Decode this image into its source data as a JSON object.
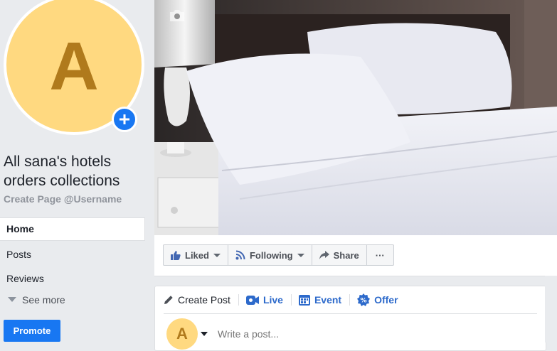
{
  "page": {
    "avatar_letter": "A",
    "name": "All sana's hotels orders collections",
    "username_link": "Create Page @Username"
  },
  "nav": {
    "items": [
      {
        "label": "Home",
        "active": true
      },
      {
        "label": "Posts",
        "active": false
      },
      {
        "label": "Reviews",
        "active": false
      }
    ],
    "see_more": "See more"
  },
  "promote_label": "Promote",
  "actions": {
    "liked": "Liked",
    "following": "Following",
    "share": "Share",
    "more": "···"
  },
  "create_post": {
    "tabs": [
      {
        "label": "Create Post",
        "icon": "pencil-icon"
      },
      {
        "label": "Live",
        "icon": "live-video-icon"
      },
      {
        "label": "Event",
        "icon": "calendar-icon"
      },
      {
        "label": "Offer",
        "icon": "offer-icon"
      }
    ],
    "avatar_letter": "A",
    "placeholder": "Write a post..."
  },
  "colors": {
    "accent": "#1877f2",
    "avatar_bg": "#ffd980",
    "avatar_letter": "#b07a1c"
  }
}
